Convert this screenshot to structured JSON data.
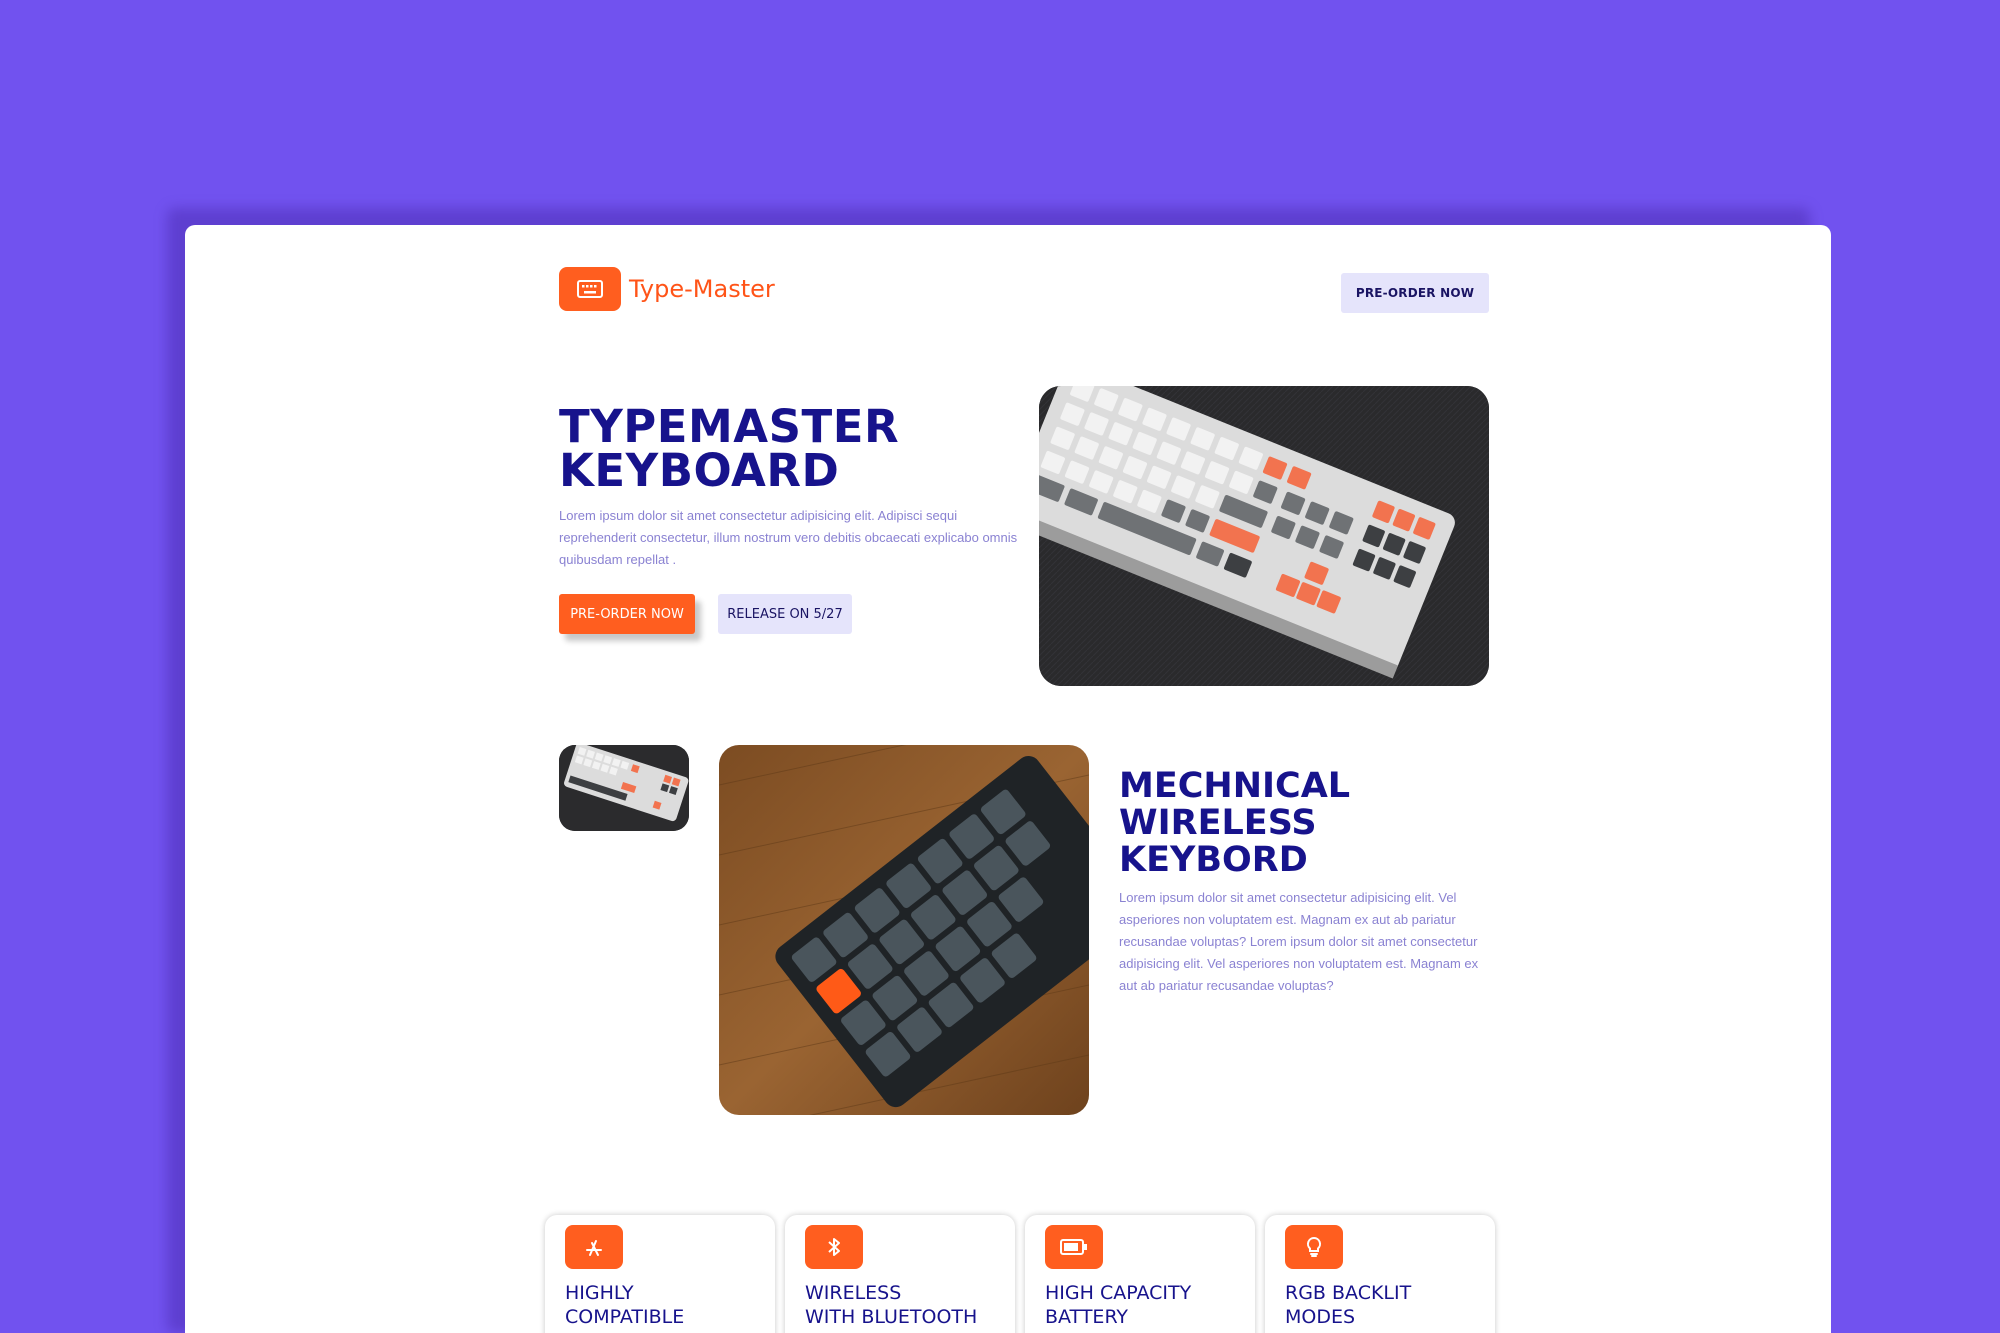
{
  "brand": {
    "name": "Type-Master",
    "icon": "keyboard-icon"
  },
  "header": {
    "preorder_label": "PRE-ORDER NOW"
  },
  "hero": {
    "title": "TYPEMASTER KEYBOARD",
    "description": "Lorem ipsum dolor sit amet consectetur adipisicing elit. Adipisci sequi reprehenderit consectetur, illum nostrum vero debitis obcaecati explicabo omnis quibusdam repellat .",
    "primary_button": "PRE-ORDER NOW",
    "secondary_button": "RELEASE ON 5/27",
    "image": "white-orange-mechanical-keyboard-photo"
  },
  "section2": {
    "title": "MECHNICAL WIRELESS KEYBORD",
    "description": "Lorem ipsum dolor sit amet consectetur adipisicing elit. Vel asperiores non voluptatem est. Magnam ex aut ab pariatur recusandae voluptas? Lorem ipsum dolor sit amet consectetur adipisicing elit. Vel asperiores non voluptatem est. Magnam ex aut ab pariatur recusandae voluptas?",
    "thumb_image": "white-keyboard-thumbnail",
    "main_image": "dark-keyboard-on-wood-photo"
  },
  "features": [
    {
      "title": "HIGHLY\nCOMPATIBLE",
      "icon": "app-store-icon"
    },
    {
      "title": "WIRELESS\nWITH BLUETOOTH",
      "icon": "bluetooth-icon"
    },
    {
      "title": "HIGH CAPACITY\nBATTERY",
      "icon": "battery-icon"
    },
    {
      "title": "RGB BACKLIT\nMODES",
      "icon": "lightbulb-icon"
    }
  ],
  "colors": {
    "background": "#7152ef",
    "accent": "#ff5e1f",
    "heading": "#17138c",
    "body_text": "#8a82d2",
    "light_button": "#e5e4fb"
  }
}
